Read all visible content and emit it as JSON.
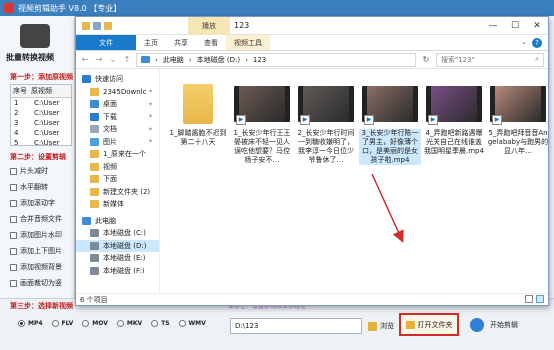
{
  "bg_app": {
    "title": "视频剪辑助手 V8.0 【专业】",
    "logo_label": "批量转换视频",
    "step1": "第一步：添加原视频",
    "table_headers": [
      "序号",
      "原视频"
    ],
    "rows": [
      {
        "n": "1",
        "p": "C:\\User"
      },
      {
        "n": "2",
        "p": "C:\\User"
      },
      {
        "n": "3",
        "p": "C:\\User"
      },
      {
        "n": "4",
        "p": "C:\\User"
      },
      {
        "n": "5",
        "p": "C:\\User"
      }
    ],
    "step2": "第二步：设置剪辑",
    "options": [
      "片头减时",
      "水平翻转",
      "添加滚动字",
      "合并音频文件",
      "添加图片水印",
      "添加上下图片",
      "添加视频背景",
      "画面裁切为竖"
    ],
    "step3": "第三步：选择新视频",
    "note": "保存在：设置新视频保存路径",
    "formats": [
      "MP4",
      "FLV",
      "MOV",
      "MKV",
      "TS",
      "WMV"
    ],
    "selected_format": "MP4",
    "path_value": "D:\\123",
    "browse_label": "浏览",
    "open_folder_label": "打开文件夹",
    "start_label": "开始剪辑",
    "accent_red": "#d42a2a"
  },
  "explorer": {
    "context_tab": "播放",
    "title": "123",
    "window_buttons": [
      "—",
      "☐",
      "✕"
    ],
    "ribbon_tabs": [
      "文件",
      "主页",
      "共享",
      "查看",
      "视频工具"
    ],
    "breadcrumb": [
      "此电脑",
      "本地磁盘 (D:)",
      "123"
    ],
    "search_placeholder": "搜索\"123\"",
    "nav_items": [
      {
        "label": "快速访问",
        "icon": "star-icon",
        "color": "#2a7bd4",
        "sub": false,
        "pinned": false,
        "selected": false
      },
      {
        "label": "2345Downlc",
        "icon": "folder-icon",
        "color": "#e8b64a",
        "sub": true,
        "pinned": true,
        "selected": false
      },
      {
        "label": "桌面",
        "icon": "desktop-icon",
        "color": "#3d8bd6",
        "sub": true,
        "pinned": true,
        "selected": false
      },
      {
        "label": "下载",
        "icon": "download-icon",
        "color": "#2a7bd4",
        "sub": true,
        "pinned": true,
        "selected": false
      },
      {
        "label": "文档",
        "icon": "document-icon",
        "color": "#9aa7b5",
        "sub": true,
        "pinned": true,
        "selected": false
      },
      {
        "label": "图片",
        "icon": "picture-icon",
        "color": "#4aa0d8",
        "sub": true,
        "pinned": true,
        "selected": false
      },
      {
        "label": "1_原来在一个",
        "icon": "folder-icon",
        "color": "#e8b64a",
        "sub": true,
        "pinned": false,
        "selected": false
      },
      {
        "label": "视频",
        "icon": "folder-icon",
        "color": "#e8b64a",
        "sub": true,
        "pinned": false,
        "selected": false
      },
      {
        "label": "下面",
        "icon": "folder-icon",
        "color": "#e8b64a",
        "sub": true,
        "pinned": false,
        "selected": false
      },
      {
        "label": "新建文件夹 (2)",
        "icon": "folder-icon",
        "color": "#e8b64a",
        "sub": true,
        "pinned": false,
        "selected": false
      },
      {
        "label": "新媒体",
        "icon": "folder-icon",
        "color": "#e8b64a",
        "sub": true,
        "pinned": false,
        "selected": false
      },
      {
        "label": "此电脑",
        "icon": "computer-icon",
        "color": "#3d8bd6",
        "sub": false,
        "pinned": false,
        "selected": false
      },
      {
        "label": "本地磁盘 (C:)",
        "icon": "drive-icon",
        "color": "#7d8a99",
        "sub": true,
        "pinned": false,
        "selected": false
      },
      {
        "label": "本地磁盘 (D:)",
        "icon": "drive-icon",
        "color": "#7d8a99",
        "sub": true,
        "pinned": false,
        "selected": true
      },
      {
        "label": "本地磁盘 (E:)",
        "icon": "drive-icon",
        "color": "#7d8a99",
        "sub": true,
        "pinned": false,
        "selected": false
      },
      {
        "label": "本地磁盘 (F:)",
        "icon": "drive-icon",
        "color": "#7d8a99",
        "sub": true,
        "pinned": false,
        "selected": false
      }
    ],
    "files": [
      {
        "name": "1_脚踏酱胞不迟到第二十八天",
        "kind": "folder",
        "thumb": "#e8b64a",
        "selected": false
      },
      {
        "name": "1_长安少年行王王晏被床不轻一见人误吃他想要？马倥杨子安不…",
        "kind": "video",
        "thumb": "#6b5a52",
        "selected": false
      },
      {
        "name": "2_长安少年行时间一到糖收嫌明了，我李淳一今日位少爷鲁休了…",
        "kind": "video",
        "thumb": "#5f5a58",
        "selected": false
      },
      {
        "name": "3_长安少年行陈一了男主，好像薄个口，是美丽的是女孩子啦.mp4",
        "kind": "video",
        "thumb": "#8a6f66",
        "selected": true
      },
      {
        "name": "4_弄跑吧新路遇曝光关自己在线谁盖我国明星季晨.mp4",
        "kind": "video",
        "thumb": "#7a4e86",
        "selected": false
      },
      {
        "name": "5_弄跑吧拜音音Angelababy与跑男的显八年…",
        "kind": "video",
        "thumb": "#b58a7a",
        "selected": false
      }
    ],
    "status": "6 个项目"
  }
}
